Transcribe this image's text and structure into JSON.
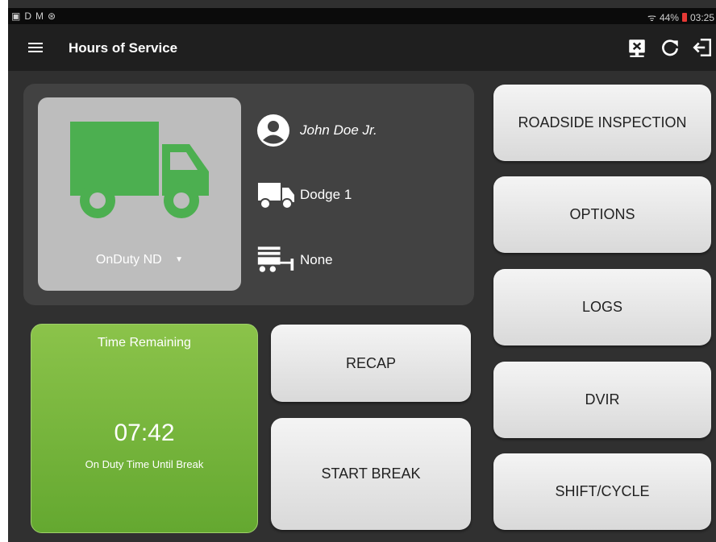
{
  "status_bar": {
    "left_icons": [
      "screen-icon",
      "d-notification",
      "gmail-icon",
      "vpn-icon"
    ],
    "left_texts": [
      "D",
      "M"
    ],
    "battery": "44%",
    "time": "03:25"
  },
  "app_bar": {
    "title": "Hours of Service",
    "icons": [
      "menu-icon",
      "transfer-icon",
      "refresh-icon",
      "logout-icon"
    ]
  },
  "status_card": {
    "status": "OnDuty ND",
    "color": "#4caf50"
  },
  "driver": {
    "name": "John Doe Jr."
  },
  "vehicle": {
    "name": "Dodge 1"
  },
  "trailer": {
    "name": "None"
  },
  "time_remaining": {
    "title": "Time Remaining",
    "value": "07:42",
    "subtitle": "On Duty Time Until Break"
  },
  "buttons": {
    "recap": "RECAP",
    "start_break": "START BREAK",
    "roadside": "ROADSIDE INSPECTION",
    "options": "OPTIONS",
    "logs": "LOGS",
    "dvir": "DVIR",
    "shift_cycle": "SHIFT/CYCLE"
  }
}
